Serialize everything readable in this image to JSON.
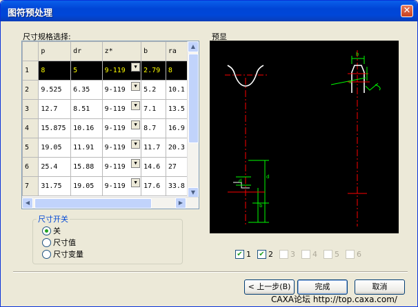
{
  "window": {
    "title": "图符预处理",
    "close_label": "✕"
  },
  "size_table_label": "尺寸规格选择:",
  "preview_label": "预显",
  "table": {
    "headers": [
      "",
      "p",
      "dr",
      "z*",
      "b",
      "ra"
    ],
    "rows": [
      [
        "1",
        "8",
        "5",
        "9-119",
        "2.79",
        "8"
      ],
      [
        "2",
        "9.525",
        "6.35",
        "9-119",
        "5.2",
        "10.1"
      ],
      [
        "3",
        "12.7",
        "8.51",
        "9-119",
        "7.1",
        "13.5"
      ],
      [
        "4",
        "15.875",
        "10.16",
        "9-119",
        "8.7",
        "16.9"
      ],
      [
        "5",
        "19.05",
        "11.91",
        "9-119",
        "11.7",
        "20.3"
      ],
      [
        "6",
        "25.4",
        "15.88",
        "9-119",
        "14.6",
        "27"
      ],
      [
        "7",
        "31.75",
        "19.05",
        "9-119",
        "17.6",
        "33.8"
      ]
    ],
    "selected_row": 0,
    "dropdown_glyph": "▼"
  },
  "dimension_switch": {
    "title": "尺寸开关",
    "options": [
      "关",
      "尺寸值",
      "尺寸变量"
    ],
    "selected": 0
  },
  "view_checkboxes": [
    {
      "label": "1",
      "checked": true,
      "enabled": true
    },
    {
      "label": "2",
      "checked": true,
      "enabled": true
    },
    {
      "label": "3",
      "checked": false,
      "enabled": false
    },
    {
      "label": "4",
      "checked": false,
      "enabled": false
    },
    {
      "label": "5",
      "checked": false,
      "enabled": false
    },
    {
      "label": "6",
      "checked": false,
      "enabled": false
    }
  ],
  "buttons": {
    "prev": "< 上一步(B)",
    "finish": "完成",
    "cancel": "取消"
  },
  "watermark": "CAXA论坛 http://top.caxa.com/",
  "colors": {
    "titlebar": "#0054E3",
    "preview_bg": "#000000",
    "selection_fg": "#FFFF00",
    "preview_red": "#FF0000",
    "preview_green": "#00FF00"
  }
}
